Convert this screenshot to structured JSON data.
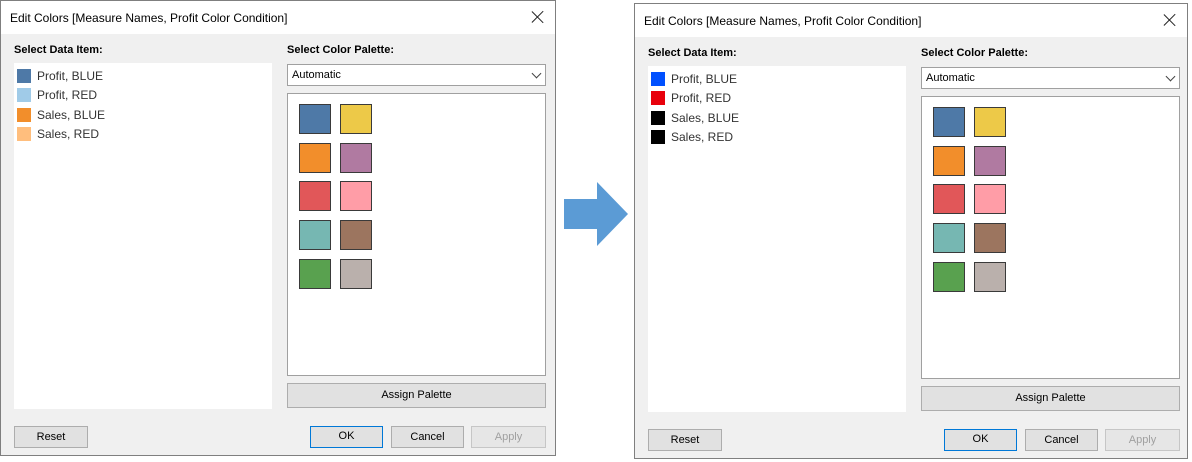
{
  "dialog_title": "Edit Colors [Measure Names, Profit Color Condition]",
  "select_data_item_label": "Select Data Item:",
  "select_palette_label": "Select Color Palette:",
  "palette_selected": "Automatic",
  "buttons": {
    "assign_palette": "Assign Palette",
    "reset": "Reset",
    "ok": "OK",
    "cancel": "Cancel",
    "apply": "Apply"
  },
  "palette_colors": [
    "#4e79a7",
    "#edc948",
    "#f28e2b",
    "#b07aa1",
    "#e15759",
    "#ff9da7",
    "#76b7b2",
    "#9c755f",
    "#59a14f",
    "#bab0ac"
  ],
  "before": {
    "items": [
      {
        "label": "Profit, BLUE",
        "color": "#4e79a7"
      },
      {
        "label": "Profit, RED",
        "color": "#a0cbe8"
      },
      {
        "label": "Sales, BLUE",
        "color": "#f28e2b"
      },
      {
        "label": "Sales, RED",
        "color": "#ffbe7d"
      }
    ]
  },
  "after": {
    "items": [
      {
        "label": "Profit, BLUE",
        "color": "#0050ff"
      },
      {
        "label": "Profit, RED",
        "color": "#e8000b"
      },
      {
        "label": "Sales, BLUE",
        "color": "#000000"
      },
      {
        "label": "Sales, RED",
        "color": "#000000"
      }
    ]
  },
  "arrow_color": "#5b9bd5",
  "arrow_icon": "right-arrow-icon"
}
